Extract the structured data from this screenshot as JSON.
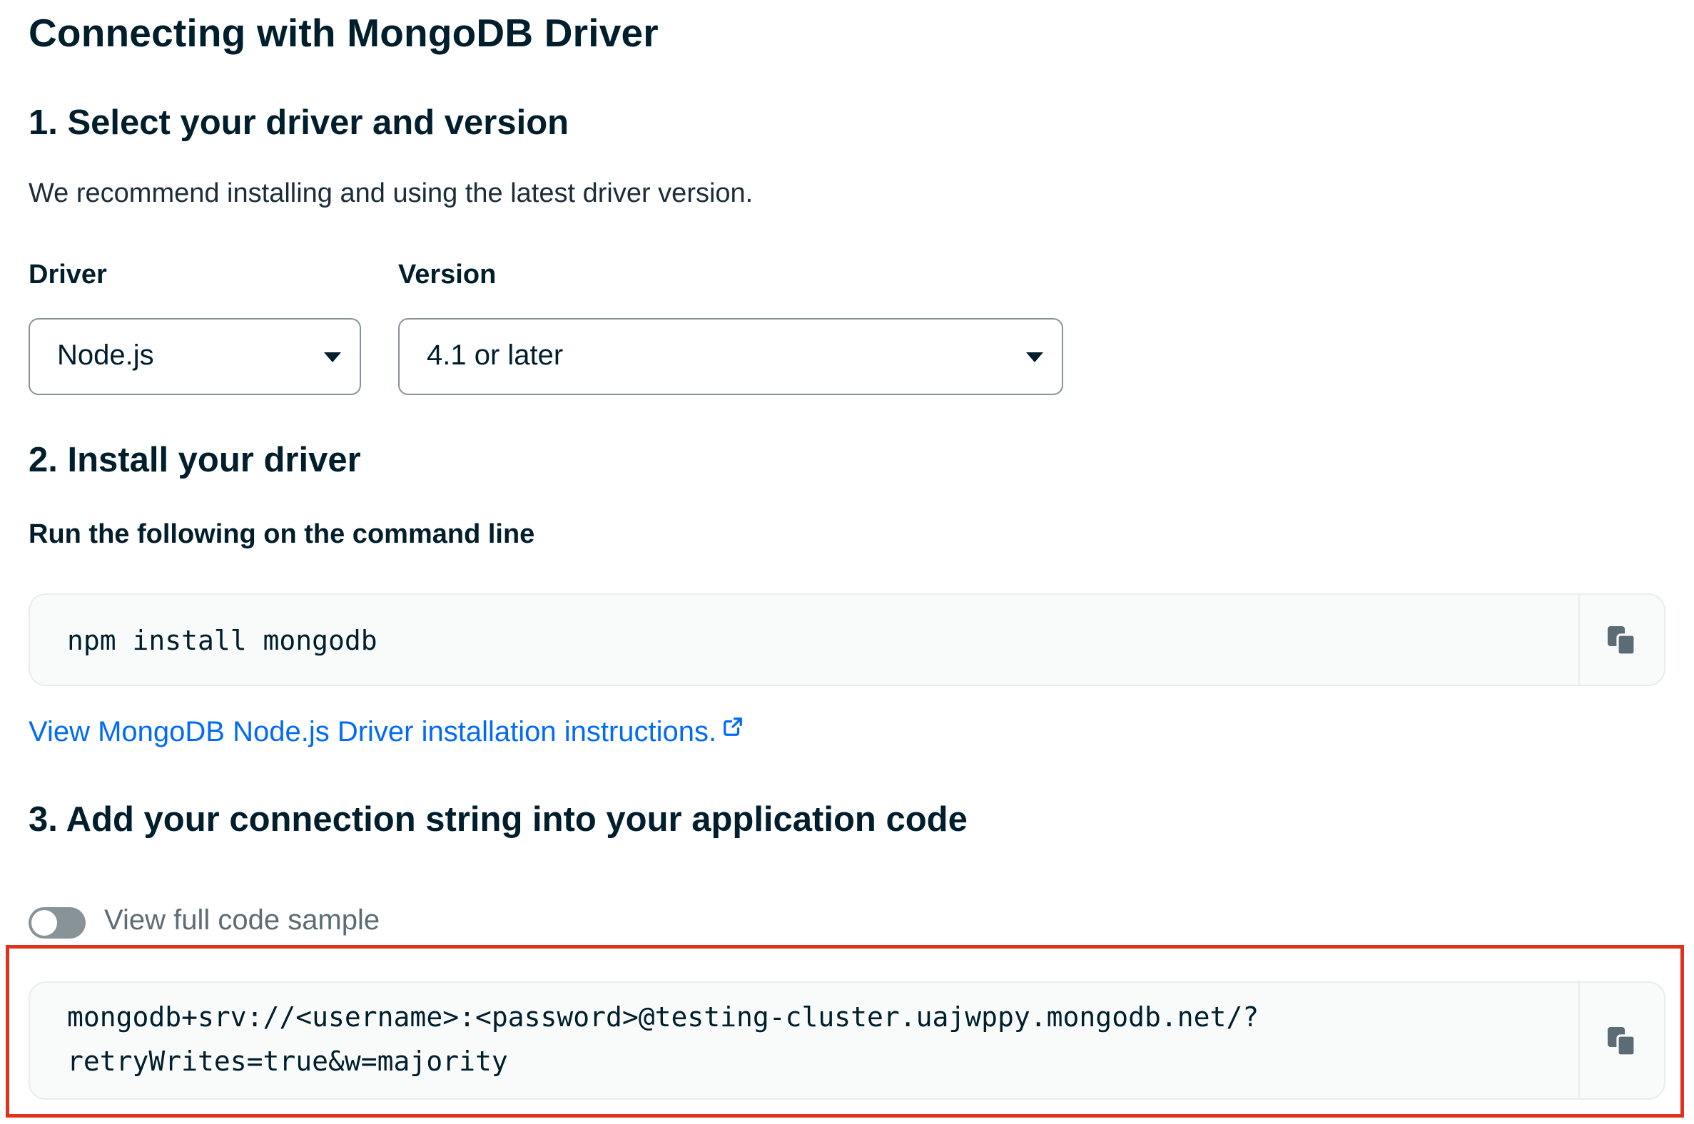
{
  "page": {
    "title": "Connecting with MongoDB Driver"
  },
  "step1": {
    "heading": "1. Select your driver and version",
    "description": "We recommend installing and using the latest driver version.",
    "driver_label": "Driver",
    "driver_value": "Node.js",
    "version_label": "Version",
    "version_value": "4.1 or later"
  },
  "step2": {
    "heading": "2. Install your driver",
    "subheading": "Run the following on the command line",
    "command": "npm install mongodb",
    "copy_icon": "copy-icon",
    "link_text": "View MongoDB Node.js Driver installation instructions.",
    "link_icon": "external-link-icon"
  },
  "step3": {
    "heading": "3. Add your connection string into your application code",
    "toggle_label": "View full code sample",
    "toggle_on": false,
    "connection_string_line1": "mongodb+srv://<username>:<password>@testing-cluster.uajwppy.mongodb.net/?",
    "connection_string_line2": "retryWrites=true&w=majority",
    "copy_icon": "copy-icon"
  },
  "colors": {
    "text": "#001e2b",
    "link": "#016bf8",
    "highlight_border": "#e0331e",
    "code_background": "#f9fbfa"
  }
}
